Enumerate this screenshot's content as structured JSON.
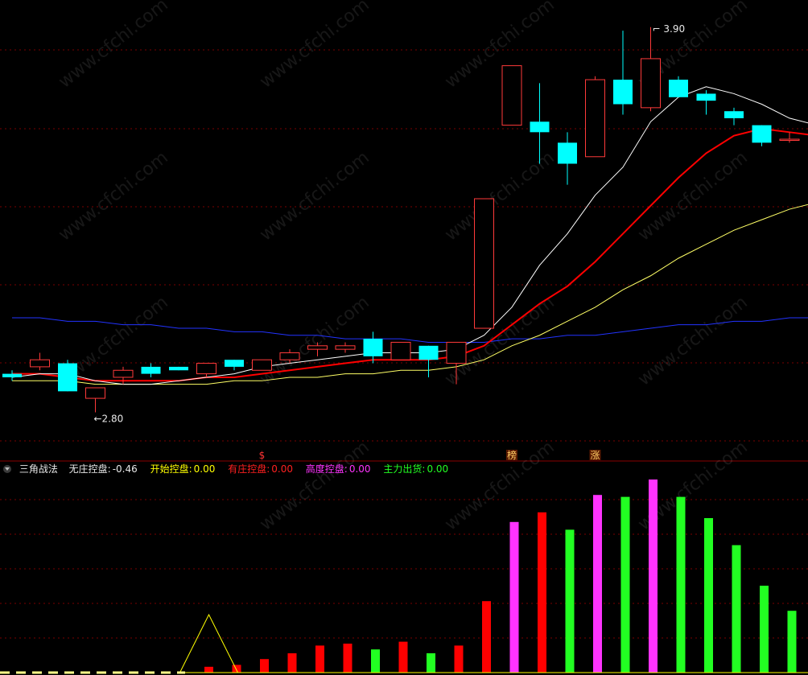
{
  "header_partial": "",
  "price_annotations": {
    "high_label": "3.90",
    "low_label": "2.80"
  },
  "markers": [
    "$",
    "榜",
    "涨"
  ],
  "indicator": {
    "name": "三角战法",
    "fields": [
      {
        "label": "无庄控盘:",
        "value": "-0.46",
        "color": "#e8e8e8"
      },
      {
        "label": "开始控盘:",
        "value": "0.00",
        "color": "#ffff00"
      },
      {
        "label": "有庄控盘:",
        "value": "0.00",
        "color": "#ff2020"
      },
      {
        "label": "高度控盘:",
        "value": "0.00",
        "color": "#ff33ff"
      },
      {
        "label": "主力出货:",
        "value": "0.00",
        "color": "#22ff22"
      }
    ]
  },
  "watermark": "www.cfchi.com",
  "colors": {
    "up": "#ff3a3a",
    "down": "#00ffff",
    "ma_white": "#ffffff",
    "ma_red": "#ff0000",
    "ma_yellow": "#ffff66",
    "ma_blue": "#2233ff",
    "grid": "#7a0000",
    "bar_red": "#ff0000",
    "bar_magenta": "#ff33ff",
    "bar_green": "#22ff22",
    "triangle": "#ffff00"
  },
  "chart_data": {
    "type": "candlestick",
    "price_range": [
      2.7,
      3.95
    ],
    "candles": [
      {
        "o": 2.91,
        "c": 2.9,
        "h": 2.92,
        "l": 2.89
      },
      {
        "o": 2.93,
        "c": 2.95,
        "h": 2.97,
        "l": 2.92
      },
      {
        "o": 2.94,
        "c": 2.86,
        "h": 2.95,
        "l": 2.86
      },
      {
        "o": 2.84,
        "c": 2.87,
        "h": 2.87,
        "l": 2.8
      },
      {
        "o": 2.9,
        "c": 2.92,
        "h": 2.93,
        "l": 2.88
      },
      {
        "o": 2.93,
        "c": 2.91,
        "h": 2.94,
        "l": 2.9
      },
      {
        "o": 2.93,
        "c": 2.92,
        "h": 2.93,
        "l": 2.92
      },
      {
        "o": 2.91,
        "c": 2.94,
        "h": 2.94,
        "l": 2.9
      },
      {
        "o": 2.95,
        "c": 2.93,
        "h": 2.95,
        "l": 2.92
      },
      {
        "o": 2.92,
        "c": 2.95,
        "h": 2.95,
        "l": 2.92
      },
      {
        "o": 2.95,
        "c": 2.97,
        "h": 2.98,
        "l": 2.94
      },
      {
        "o": 2.98,
        "c": 2.99,
        "h": 3.0,
        "l": 2.96
      },
      {
        "o": 2.98,
        "c": 2.99,
        "h": 3.0,
        "l": 2.97
      },
      {
        "o": 3.01,
        "c": 2.96,
        "h": 3.03,
        "l": 2.94
      },
      {
        "o": 2.95,
        "c": 3.0,
        "h": 3.0,
        "l": 2.95
      },
      {
        "o": 2.99,
        "c": 2.95,
        "h": 2.99,
        "l": 2.9
      },
      {
        "o": 2.94,
        "c": 3.0,
        "h": 3.0,
        "l": 2.88
      },
      {
        "o": 3.04,
        "c": 3.41,
        "h": 3.41,
        "l": 3.04
      },
      {
        "o": 3.62,
        "c": 3.79,
        "h": 3.79,
        "l": 3.62
      },
      {
        "o": 3.63,
        "c": 3.6,
        "h": 3.74,
        "l": 3.51
      },
      {
        "o": 3.57,
        "c": 3.51,
        "h": 3.6,
        "l": 3.45
      },
      {
        "o": 3.53,
        "c": 3.75,
        "h": 3.76,
        "l": 3.53
      },
      {
        "o": 3.75,
        "c": 3.68,
        "h": 3.89,
        "l": 3.65
      },
      {
        "o": 3.67,
        "c": 3.81,
        "h": 3.9,
        "l": 3.66
      },
      {
        "o": 3.75,
        "c": 3.7,
        "h": 3.76,
        "l": 3.7
      },
      {
        "o": 3.71,
        "c": 3.69,
        "h": 3.72,
        "l": 3.65
      },
      {
        "o": 3.66,
        "c": 3.64,
        "h": 3.67,
        "l": 3.62
      },
      {
        "o": 3.62,
        "c": 3.57,
        "h": 3.62,
        "l": 3.56
      },
      {
        "o": 3.58,
        "c": 3.58,
        "h": 3.6,
        "l": 3.57
      }
    ],
    "ma_white": [
      2.9,
      2.91,
      2.91,
      2.89,
      2.88,
      2.88,
      2.89,
      2.9,
      2.91,
      2.93,
      2.94,
      2.95,
      2.96,
      2.97,
      2.97,
      2.97,
      2.98,
      3.02,
      3.1,
      3.22,
      3.31,
      3.42,
      3.5,
      3.63,
      3.7,
      3.73,
      3.71,
      3.68,
      3.64,
      3.62
    ],
    "ma_red": [
      2.91,
      2.91,
      2.9,
      2.89,
      2.89,
      2.89,
      2.89,
      2.9,
      2.9,
      2.91,
      2.92,
      2.93,
      2.94,
      2.95,
      2.95,
      2.95,
      2.96,
      2.99,
      3.05,
      3.11,
      3.16,
      3.23,
      3.31,
      3.39,
      3.47,
      3.54,
      3.59,
      3.61,
      3.6,
      3.59
    ],
    "ma_yellow": [
      2.89,
      2.89,
      2.89,
      2.88,
      2.88,
      2.88,
      2.88,
      2.88,
      2.89,
      2.89,
      2.9,
      2.9,
      2.91,
      2.91,
      2.92,
      2.92,
      2.93,
      2.95,
      2.99,
      3.02,
      3.06,
      3.1,
      3.15,
      3.19,
      3.24,
      3.28,
      3.32,
      3.35,
      3.38,
      3.4
    ],
    "ma_blue": [
      3.07,
      3.07,
      3.06,
      3.06,
      3.05,
      3.05,
      3.04,
      3.04,
      3.03,
      3.03,
      3.02,
      3.02,
      3.01,
      3.01,
      3.01,
      3.0,
      3.0,
      3.0,
      3.01,
      3.01,
      3.02,
      3.02,
      3.03,
      3.04,
      3.05,
      3.05,
      3.06,
      3.06,
      3.07,
      3.07
    ],
    "indicator_bars": [
      {
        "v": 0,
        "c": "none"
      },
      {
        "v": 0,
        "c": "none"
      },
      {
        "v": 0,
        "c": "none"
      },
      {
        "v": 0,
        "c": "none"
      },
      {
        "v": 0,
        "c": "none"
      },
      {
        "v": 0,
        "c": "none"
      },
      {
        "v": 0,
        "c": "none"
      },
      {
        "v": 0.03,
        "c": "red"
      },
      {
        "v": 0.04,
        "c": "red"
      },
      {
        "v": 0.07,
        "c": "red"
      },
      {
        "v": 0.1,
        "c": "red"
      },
      {
        "v": 0.14,
        "c": "red"
      },
      {
        "v": 0.15,
        "c": "red"
      },
      {
        "v": 0.12,
        "c": "green"
      },
      {
        "v": 0.16,
        "c": "red"
      },
      {
        "v": 0.1,
        "c": "green"
      },
      {
        "v": 0.14,
        "c": "red"
      },
      {
        "v": 0.37,
        "c": "red"
      },
      {
        "v": 0.78,
        "c": "magenta"
      },
      {
        "v": 0.83,
        "c": "red"
      },
      {
        "v": 0.74,
        "c": "green"
      },
      {
        "v": 0.92,
        "c": "magenta"
      },
      {
        "v": 0.91,
        "c": "green"
      },
      {
        "v": 1.0,
        "c": "magenta"
      },
      {
        "v": 0.91,
        "c": "green"
      },
      {
        "v": 0.8,
        "c": "green"
      },
      {
        "v": 0.66,
        "c": "green"
      },
      {
        "v": 0.45,
        "c": "green"
      },
      {
        "v": 0.32,
        "c": "green"
      }
    ],
    "triangle_peak_index": 7,
    "triangle_peak_value": 0.3
  }
}
